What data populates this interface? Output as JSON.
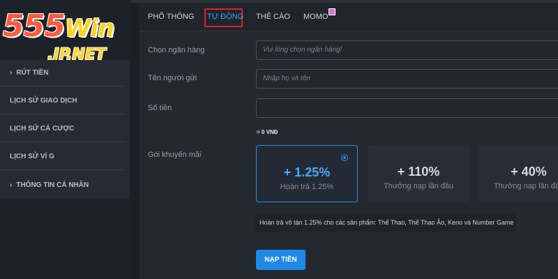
{
  "logo": {
    "line1_number": "555",
    "line1_word": "Win",
    "line2": ".JP.NET"
  },
  "sidebar": {
    "items": [
      {
        "label": "RÚT TIỀN"
      },
      {
        "label": "LỊCH SỬ GIAO DỊCH"
      },
      {
        "label": "LỊCH SỬ CÁ CƯỢC"
      },
      {
        "label": "LỊCH SỬ VÍ G"
      },
      {
        "label": "THÔNG TIN CÁ NHÂN"
      }
    ],
    "expand_icon": "chevron-right-icon"
  },
  "tabs": [
    {
      "label": "PHỔ THÔNG",
      "active": false
    },
    {
      "label": "TỰ ĐỘNG",
      "active": true
    },
    {
      "label": "THẺ CÀO",
      "active": false
    },
    {
      "label": "MOMO",
      "active": false,
      "badge_icon": "new-badge-icon"
    }
  ],
  "form": {
    "bank": {
      "label": "Chọn ngân hàng",
      "placeholder": "Vui lòng chọn ngân hàng!"
    },
    "sender": {
      "label": "Tên người gửi",
      "placeholder": "Nhập họ và tên"
    },
    "amount": {
      "label": "Số tiền",
      "value": ""
    },
    "amount_total": "= 0 VNĐ",
    "promo_label": "Gói khuyến mãi"
  },
  "promos": [
    {
      "value": "+ 1.25%",
      "desc": "Hoàn trả 1.25%",
      "selected": true
    },
    {
      "value": "+ 110%",
      "desc": "Thưởng nạp lần đầu",
      "selected": false
    },
    {
      "value": "+ 40%",
      "desc": "Thưởng nạp lần đầu",
      "selected": false
    }
  ],
  "tooltip": "Hoàn trả vô tận 1.25% cho các sản phẩm: Thể Thao, Thể Thao Ảo, Keno và Number Game",
  "submit_label": "NẠP TIỀN",
  "colors": {
    "accent": "#1f88e8",
    "active_tab": "#3aa0ff",
    "highlight_box": "#e0202a",
    "logo_red": "#ff5a3c",
    "logo_yellow": "#ffd21e"
  }
}
